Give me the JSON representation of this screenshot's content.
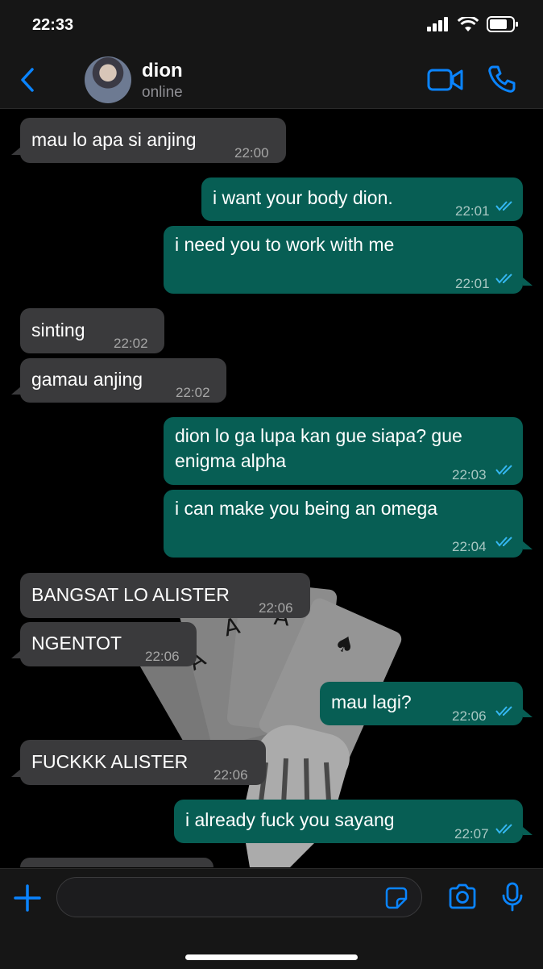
{
  "status_bar": {
    "time": "22:33"
  },
  "header": {
    "name": "dion",
    "status": "online"
  },
  "messages": [
    {
      "dir": "in",
      "text": "mau lo apa si anjing",
      "time": "22:00"
    },
    {
      "dir": "out",
      "text": "i want your body dion.",
      "time": "22:01",
      "read": true
    },
    {
      "dir": "out",
      "text": "i need you to work with me",
      "time": "22:01",
      "read": true
    },
    {
      "dir": "in",
      "text": "sinting",
      "time": "22:02"
    },
    {
      "dir": "in",
      "text": "gamau anjing",
      "time": "22:02"
    },
    {
      "dir": "out",
      "text_line1": "dion lo ga lupa kan gue siapa? gue",
      "text_line2": "enigma alpha",
      "time": "22:03",
      "read": true
    },
    {
      "dir": "out",
      "text": "i can make you being an omega",
      "time": "22:04",
      "read": true
    },
    {
      "dir": "in",
      "text": "BANGSAT LO ALISTER",
      "time": "22:06"
    },
    {
      "dir": "in",
      "text": "NGENTOT",
      "time": "22:06"
    },
    {
      "dir": "out",
      "text": "mau lagi?",
      "time": "22:06",
      "read": true
    },
    {
      "dir": "in",
      "text": "FUCKKK ALISTER",
      "time": "22:06"
    },
    {
      "dir": "out",
      "text": "i already fuck you sayang",
      "time": "22:07",
      "read": true
    }
  ],
  "colors": {
    "accent": "#0a84ff",
    "outgoing_bubble": "#075e54",
    "incoming_bubble": "#3a3a3c",
    "read_tick": "#34b7f1"
  },
  "icons": [
    "back-chevron-icon",
    "video-call-icon",
    "phone-icon",
    "plus-icon",
    "sticker-icon",
    "camera-icon",
    "microphone-icon",
    "signal-icon",
    "wifi-icon",
    "battery-icon"
  ]
}
